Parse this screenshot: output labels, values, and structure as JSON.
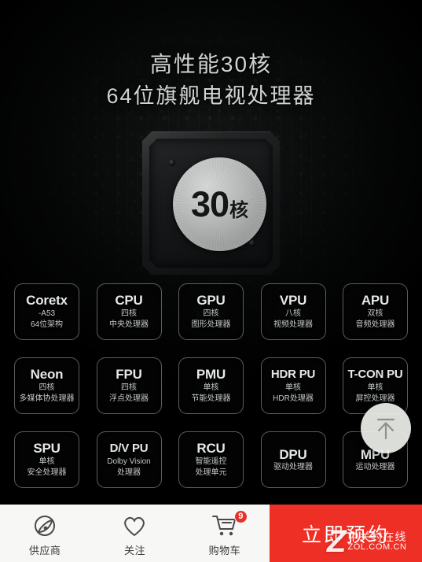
{
  "hero": {
    "headline_line1": "高性能30核",
    "headline_line2": "64位旗舰电视处理器",
    "chip_number": "30",
    "chip_unit": "核"
  },
  "modules": [
    [
      {
        "title": "Coretx",
        "sub1": "-A53",
        "sub2": "64位架构"
      },
      {
        "title": "CPU",
        "sub1": "四核",
        "sub2": "中央处理器"
      },
      {
        "title": "GPU",
        "sub1": "四核",
        "sub2": "图形处理器"
      },
      {
        "title": "VPU",
        "sub1": "八核",
        "sub2": "视频处理器"
      },
      {
        "title": "APU",
        "sub1": "双核",
        "sub2": "音频处理器"
      }
    ],
    [
      {
        "title": "Neon",
        "sub1": "四核",
        "sub2": "多媒体协处理器"
      },
      {
        "title": "FPU",
        "sub1": "四核",
        "sub2": "浮点处理器"
      },
      {
        "title": "PMU",
        "sub1": "单核",
        "sub2": "节能处理器"
      },
      {
        "title": "HDR PU",
        "sub1": "单核",
        "sub2": "HDR处理器"
      },
      {
        "title": "T-CON PU",
        "sub1": "单核",
        "sub2": "屏控处理器"
      }
    ],
    [
      {
        "title": "SPU",
        "sub1": "单核",
        "sub2": "安全处理器"
      },
      {
        "title": "D/V PU",
        "sub1": "Dolby Vision",
        "sub2": "处理器"
      },
      {
        "title": "RCU",
        "sub1": "智能遥控",
        "sub2": "处理单元"
      },
      {
        "title": "DPU",
        "sub1": "",
        "sub2": "驱动处理器"
      },
      {
        "title": "MPU",
        "sub1": "",
        "sub2": "运动处理器"
      }
    ]
  ],
  "fab": {
    "icon": "arrow-up-icon"
  },
  "bottom_bar": {
    "items": [
      {
        "icon": "supplier-icon",
        "label": "供应商",
        "badge": ""
      },
      {
        "icon": "heart-icon",
        "label": "关注",
        "badge": ""
      },
      {
        "icon": "cart-icon",
        "label": "购物车",
        "badge": "9"
      }
    ],
    "cta_label": "立即预约",
    "cta_color": "#ed2f26"
  },
  "watermark": {
    "logo": "Z",
    "line1": "中关村在线",
    "line2": "ZOL.COM.CN"
  }
}
